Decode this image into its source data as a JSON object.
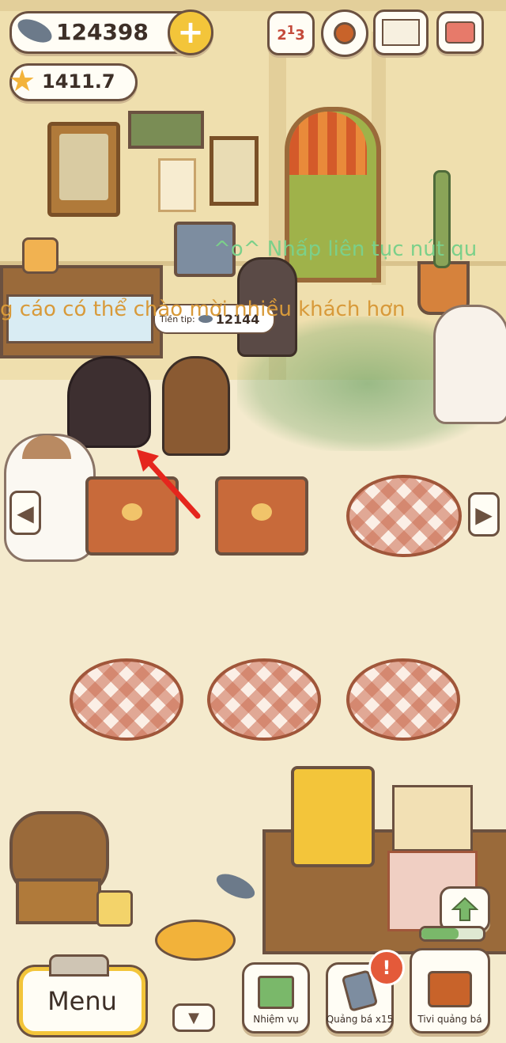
{
  "hud": {
    "fish_count": "124398",
    "star_count": "1411.7",
    "add_symbol": "+"
  },
  "top_buttons": {
    "ranking_icon": "ranking-icon",
    "settings_icon": "gear-icon",
    "catalog_icon": "book-icon",
    "camera_icon": "camera-icon"
  },
  "overlay": {
    "line1": "^o^ Nhấp liên tục nút qu",
    "line2": "g cáo có thể chào mời nhiều khách hơn"
  },
  "tip_bubble": {
    "label": "Tiền tip:",
    "value": "12144"
  },
  "bottom_bar": {
    "menu_label": "Menu",
    "quest_label": "Nhiệm vụ",
    "ad_label": "Quảng bá x15",
    "tv_label": "Tivi quảng bá",
    "alert": "!"
  },
  "colors": {
    "outline": "#6b5140",
    "yellow": "#f3c53a",
    "overlay_green": "#7bd08a",
    "overlay_orange": "#d89a3a",
    "arrow_red": "#e5261d"
  }
}
